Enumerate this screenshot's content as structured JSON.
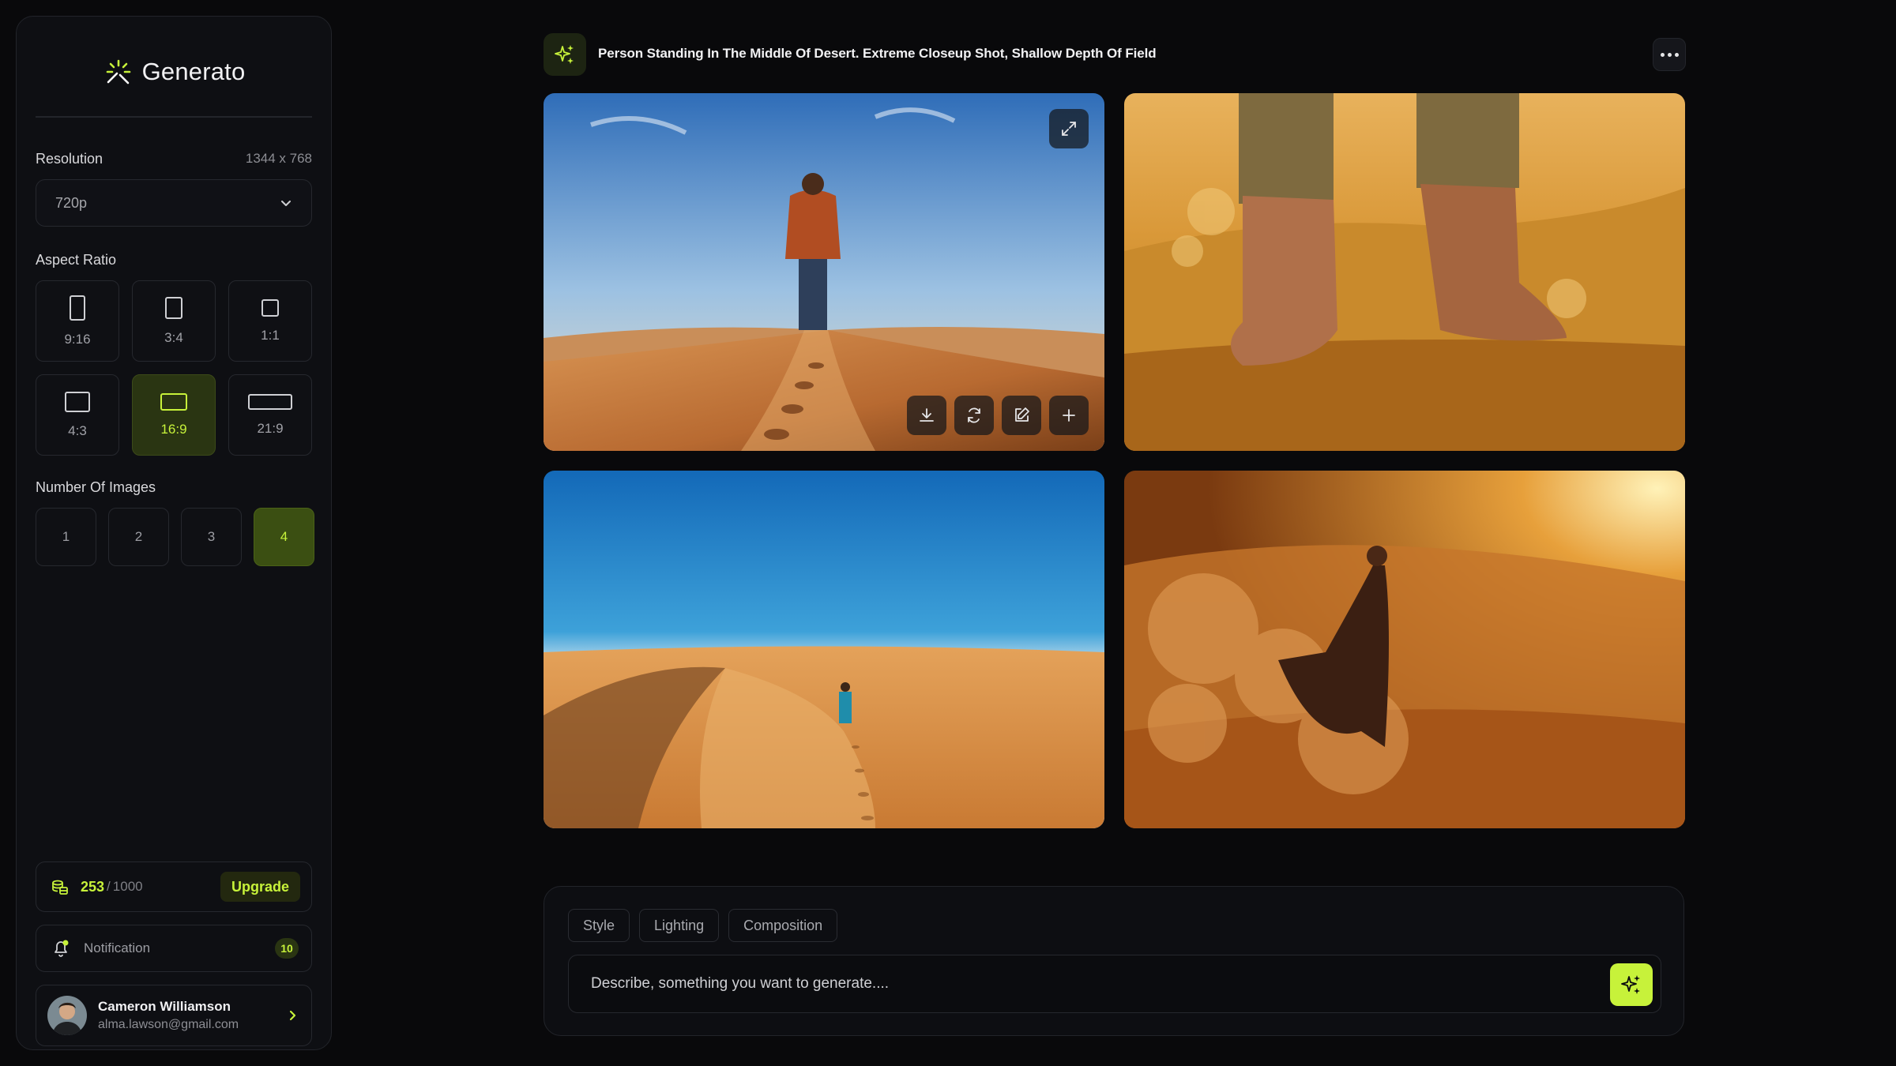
{
  "app": {
    "name": "Generato",
    "accent": "#c7f23a"
  },
  "sidebar": {
    "resolution": {
      "label": "Resolution",
      "value": "1344 x 768",
      "selected": "720p"
    },
    "aspect_ratio": {
      "label": "Aspect Ratio",
      "options": [
        "9:16",
        "3:4",
        "1:1",
        "4:3",
        "16:9",
        "21:9"
      ],
      "selected": "16:9"
    },
    "number_of_images": {
      "label": "Number Of Images",
      "options": [
        "1",
        "2",
        "3",
        "4"
      ],
      "selected": "4"
    },
    "credits": {
      "used": "253",
      "separator": "/",
      "total": "1000",
      "upgrade_label": "Upgrade"
    },
    "notification": {
      "label": "Notification",
      "count": "10"
    },
    "user": {
      "name": "Cameron Williamson",
      "email": "alma.lawson@gmail.com"
    }
  },
  "main": {
    "prompt_title": "Person Standing In The Middle Of Desert. Extreme Closeup Shot, Shallow Depth Of Field",
    "images": [
      {
        "icon": "image-man-on-dune"
      },
      {
        "icon": "image-feet-in-sand"
      },
      {
        "icon": "image-walker-blue-sky"
      },
      {
        "icon": "image-woman-dust"
      }
    ],
    "composer": {
      "chips": [
        "Style",
        "Lighting",
        "Composition"
      ],
      "placeholder": "Describe, something you want to generate...."
    }
  }
}
